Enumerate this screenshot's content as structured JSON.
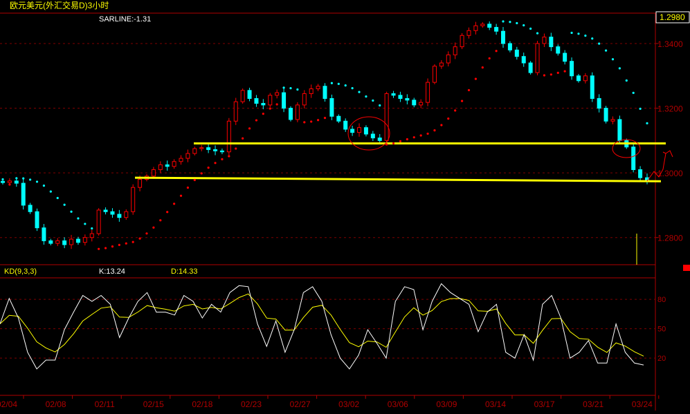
{
  "header": {
    "title": "欧元美元(外汇交易D)3小时",
    "indicator": "SARLINE:-1.31"
  },
  "price_box": "1.2980",
  "kd_header": {
    "name": "KD(9,3,3)",
    "k": "K:13.24",
    "d": "D:14.33"
  },
  "colors": {
    "up": "#ff0000",
    "down": "#00ffff",
    "axis": "#b00000",
    "grid": "#800000",
    "line": "#ffff00",
    "k": "#ffffff",
    "d": "#ffff00"
  },
  "chart_data": [
    {
      "type": "candlestick",
      "title": "欧元美元(外汇交易D)3小时",
      "y_ticks": [
        {
          "v": 1.34,
          "label": "1.3400"
        },
        {
          "v": 1.32,
          "label": "1.3200"
        },
        {
          "v": 1.3,
          "label": "1.3000"
        },
        {
          "v": 1.28,
          "label": "1.2800"
        }
      ],
      "ylim": [
        1.2716,
        1.3494
      ],
      "x_ticks": [
        "02/04",
        "02/08",
        "02/11",
        "02/15",
        "02/18",
        "02/23",
        "02/27",
        "03/02",
        "03/06",
        "03/09",
        "03/14",
        "03/17",
        "03/21",
        "03/24"
      ],
      "close": [
        1.297,
        1.2975,
        1.2968,
        1.29,
        1.288,
        1.283,
        1.279,
        1.2782,
        1.279,
        1.2778,
        1.2795,
        1.2785,
        1.28,
        1.2812,
        1.2885,
        1.288,
        1.2872,
        1.2862,
        1.288,
        1.2955,
        1.298,
        1.299,
        1.301,
        1.3025,
        1.302,
        1.3035,
        1.3045,
        1.306,
        1.3075,
        1.3078,
        1.3072,
        1.3068,
        1.3065,
        1.316,
        1.322,
        1.3255,
        1.323,
        1.3215,
        1.321,
        1.324,
        1.3248,
        1.32,
        1.3165,
        1.321,
        1.3245,
        1.326,
        1.3268,
        1.323,
        1.3175,
        1.316,
        1.3135,
        1.3125,
        1.314,
        1.312,
        1.3108,
        1.31,
        1.3245,
        1.324,
        1.323,
        1.3225,
        1.321,
        1.3218,
        1.328,
        1.333,
        1.334,
        1.3365,
        1.339,
        1.3425,
        1.344,
        1.3455,
        1.346,
        1.345,
        1.3438,
        1.34,
        1.338,
        1.336,
        1.334,
        1.331,
        1.34,
        1.342,
        1.339,
        1.337,
        1.3345,
        1.33,
        1.3285,
        1.33,
        1.323,
        1.32,
        1.316,
        1.3165,
        1.31,
        1.308,
        1.301,
        1.2985,
        1.2978
      ],
      "support_lines": [
        {
          "from": 1.3091,
          "to": 1.3091
        },
        {
          "from": 1.2985,
          "to": 1.2974
        }
      ],
      "indicator": {
        "name": "SARLINE",
        "value": -1.31
      }
    },
    {
      "type": "line",
      "title": "KD(9,3,3)",
      "y_ticks": [
        80,
        50,
        20
      ],
      "ylim": [
        -18,
        102
      ],
      "series": [
        {
          "name": "K",
          "last": 13.24,
          "values": [
            55,
            81,
            61,
            26,
            9,
            18,
            18,
            49,
            67,
            84,
            78,
            84,
            75,
            41,
            61,
            78,
            87,
            67,
            67,
            64,
            84,
            78,
            61,
            75,
            67,
            87,
            94,
            93,
            55,
            32,
            58,
            26,
            49,
            87,
            93,
            78,
            44,
            20,
            9,
            23,
            49,
            35,
            20,
            78,
            93,
            90,
            49,
            78,
            96,
            87,
            81,
            75,
            47,
            67,
            75,
            26,
            20,
            44,
            18,
            75,
            84,
            61,
            20,
            26,
            38,
            15,
            15,
            55,
            26,
            15,
            13
          ]
        },
        {
          "name": "D",
          "last": 14.33
        }
      ]
    }
  ]
}
